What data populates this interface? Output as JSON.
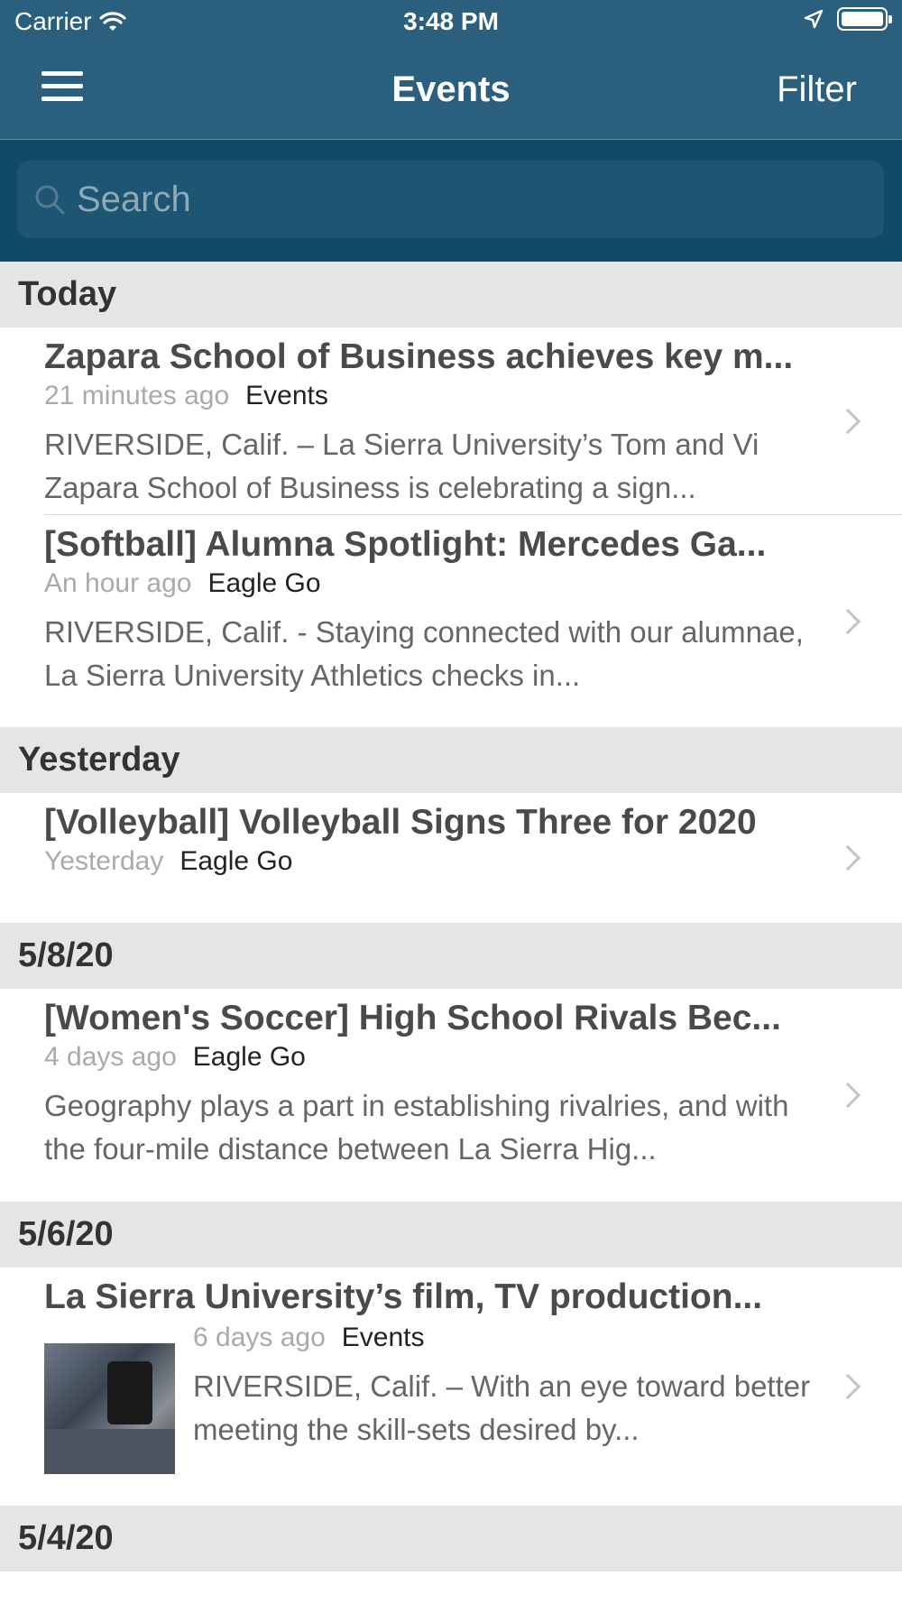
{
  "status_bar": {
    "carrier": "Carrier",
    "time": "3:48 PM"
  },
  "nav": {
    "title": "Events",
    "filter_label": "Filter"
  },
  "search": {
    "placeholder": "Search"
  },
  "sections": [
    {
      "label": "Today",
      "items": [
        {
          "title": "Zapara School of Business achieves key m...",
          "time_ago": "21 minutes ago",
          "category": "Events",
          "description": "RIVERSIDE, Calif. – La Sierra University’s Tom and Vi Zapara School of Business is celebrating a sign..."
        },
        {
          "title": "[Softball] Alumna Spotlight: Mercedes Ga...",
          "time_ago": "An hour ago",
          "category": "Eagle Go",
          "description": "RIVERSIDE, Calif. - Staying connected with our alumnae, La Sierra University Athletics checks in..."
        }
      ]
    },
    {
      "label": "Yesterday",
      "items": [
        {
          "title": "[Volleyball] Volleyball Signs Three for 2020",
          "time_ago": "Yesterday",
          "category": "Eagle Go"
        }
      ]
    },
    {
      "label": "5/8/20",
      "items": [
        {
          "title": "[Women's Soccer] High School Rivals Bec...",
          "time_ago": "4 days ago",
          "category": "Eagle Go",
          "description": "Geography plays a part in establishing rivalries, and with the four-mile distance between La Sierra Hig..."
        }
      ]
    },
    {
      "label": "5/6/20",
      "items": [
        {
          "title": "La Sierra University’s film, TV production...",
          "time_ago": "6 days ago",
          "category": "Events",
          "description": "RIVERSIDE, Calif. – With an eye toward better meeting the skill-sets desired by..."
        }
      ]
    },
    {
      "label": "5/4/20",
      "items": []
    }
  ],
  "colors": {
    "nav_bg": "#2a5f7e",
    "search_bg": "#0f4a66",
    "section_bg": "#e5e5e5"
  },
  "icons": [
    "wifi-icon",
    "location-arrow-icon",
    "battery-icon",
    "menu-icon",
    "search-icon",
    "chevron-right-icon"
  ]
}
